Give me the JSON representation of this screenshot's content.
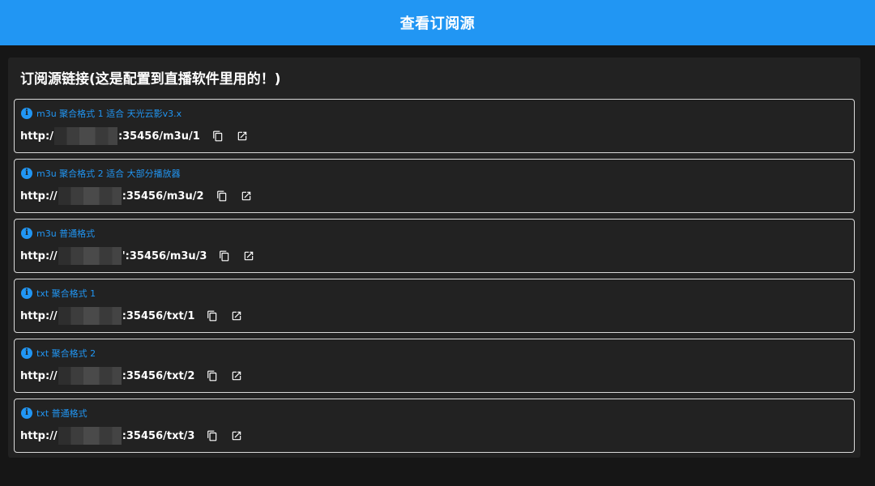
{
  "header": {
    "title": "查看订阅源"
  },
  "card": {
    "title": "订阅源链接(这是配置到直播软件里用的！)",
    "items": [
      {
        "desc": "m3u 聚合格式 1 适合 天光云影v3.x",
        "url_prefix": "http:/",
        "url_suffix": ":35456/m3u/1"
      },
      {
        "desc": "m3u 聚合格式 2 适合 大部分播放器",
        "url_prefix": "http://",
        "url_suffix": ":35456/m3u/2"
      },
      {
        "desc": "m3u 普通格式",
        "url_prefix": "http://",
        "url_suffix": "':35456/m3u/3"
      },
      {
        "desc": "txt 聚合格式 1",
        "url_prefix": "http://",
        "url_suffix": ":35456/txt/1"
      },
      {
        "desc": "txt 聚合格式 2",
        "url_prefix": "http://",
        "url_suffix": ":35456/txt/2"
      },
      {
        "desc": "txt 普通格式",
        "url_prefix": "http://",
        "url_suffix": ":35456/txt/3"
      }
    ]
  },
  "icons": {
    "info": "info-icon",
    "copy": "copy-icon",
    "open": "open-in-new-icon"
  },
  "colors": {
    "accent": "#2196f3",
    "background": "#161616",
    "card": "#222222",
    "border": "#d9d9d9"
  }
}
